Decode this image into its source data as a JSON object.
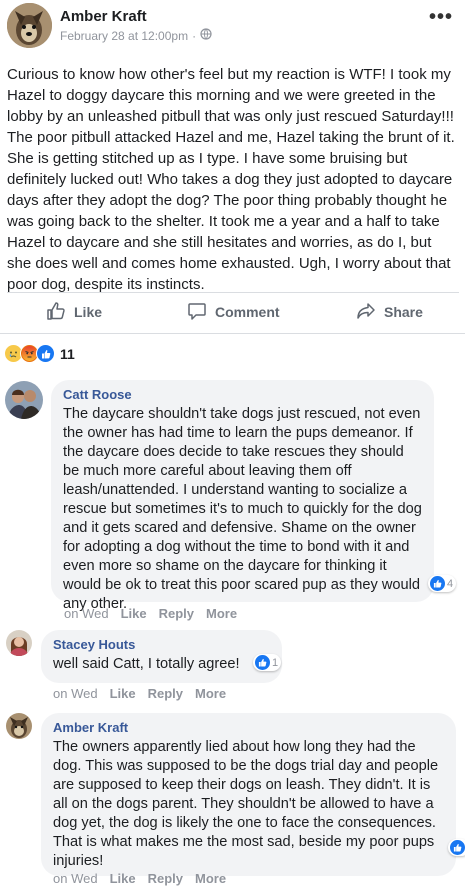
{
  "post": {
    "author": "Amber Kraft",
    "timestamp": "February 28 at 12:00pm",
    "separator": "·",
    "privacy_icon": "public-globe-icon",
    "more_label": "•••",
    "text": "Curious to know how other's feel but my reaction is WTF! I took my Hazel to doggy daycare this morning and we were greeted in the lobby by an unleashed pitbull that was only just rescued Saturday!!! The poor pitbull attacked Hazel and me, Hazel taking the brunt of it. She is getting stitched up as I type. I have some bruising but definitely lucked out! Who takes a dog they just adopted to daycare days after they adopt the dog? The poor thing probably thought he was going back to the shelter. It took me a year and a half to take Hazel to daycare and she still hesitates and worries, as do I, but she does well and comes home exhausted. Ugh, I worry about that poor dog, despite its instincts."
  },
  "actions": {
    "like": "Like",
    "comment": "Comment",
    "share": "Share"
  },
  "reactions": {
    "icons": [
      "sad",
      "angry",
      "like"
    ],
    "count": "11"
  },
  "comments": [
    {
      "name": "Catt Roose",
      "text": "The daycare shouldn't take dogs just rescued, not even the owner has had time to learn the pups demeanor. If the daycare does decide to take rescues they should be much more careful about leaving them off leash/unattended. I understand wanting to socialize a rescue but sometimes it's to much to quickly for the dog and it gets scared and defensive. Shame on the owner for adopting a dog without the time to bond with it and even more so shame on the daycare for thinking it would be ok to treat this poor scared pup as they would any other.",
      "likes": "4",
      "time": "on Wed",
      "like": "Like",
      "reply": "Reply",
      "more": "More"
    },
    {
      "name": "Stacey Houts",
      "text": "well said Catt, I totally agree!",
      "likes": "1",
      "time": "on Wed",
      "like": "Like",
      "reply": "Reply",
      "more": "More"
    },
    {
      "name": "Amber Kraft",
      "text": "The owners apparently lied about how long they had the dog. This was supposed to be the dogs trial day and people are supposed to keep their dogs on leash. They didn't. It is all on the dogs parent. They shouldn't be allowed to have a dog yet, the dog is likely the one to face the consequences. That is what makes me the most sad, beside my poor pups injuries!",
      "likes": "",
      "time": "on Wed",
      "like": "Like",
      "reply": "Reply",
      "more": "More"
    }
  ],
  "colors": {
    "link_blue": "#385898",
    "like_blue": "#1877f2",
    "muted": "#90949c",
    "bubble": "#f2f3f5"
  }
}
